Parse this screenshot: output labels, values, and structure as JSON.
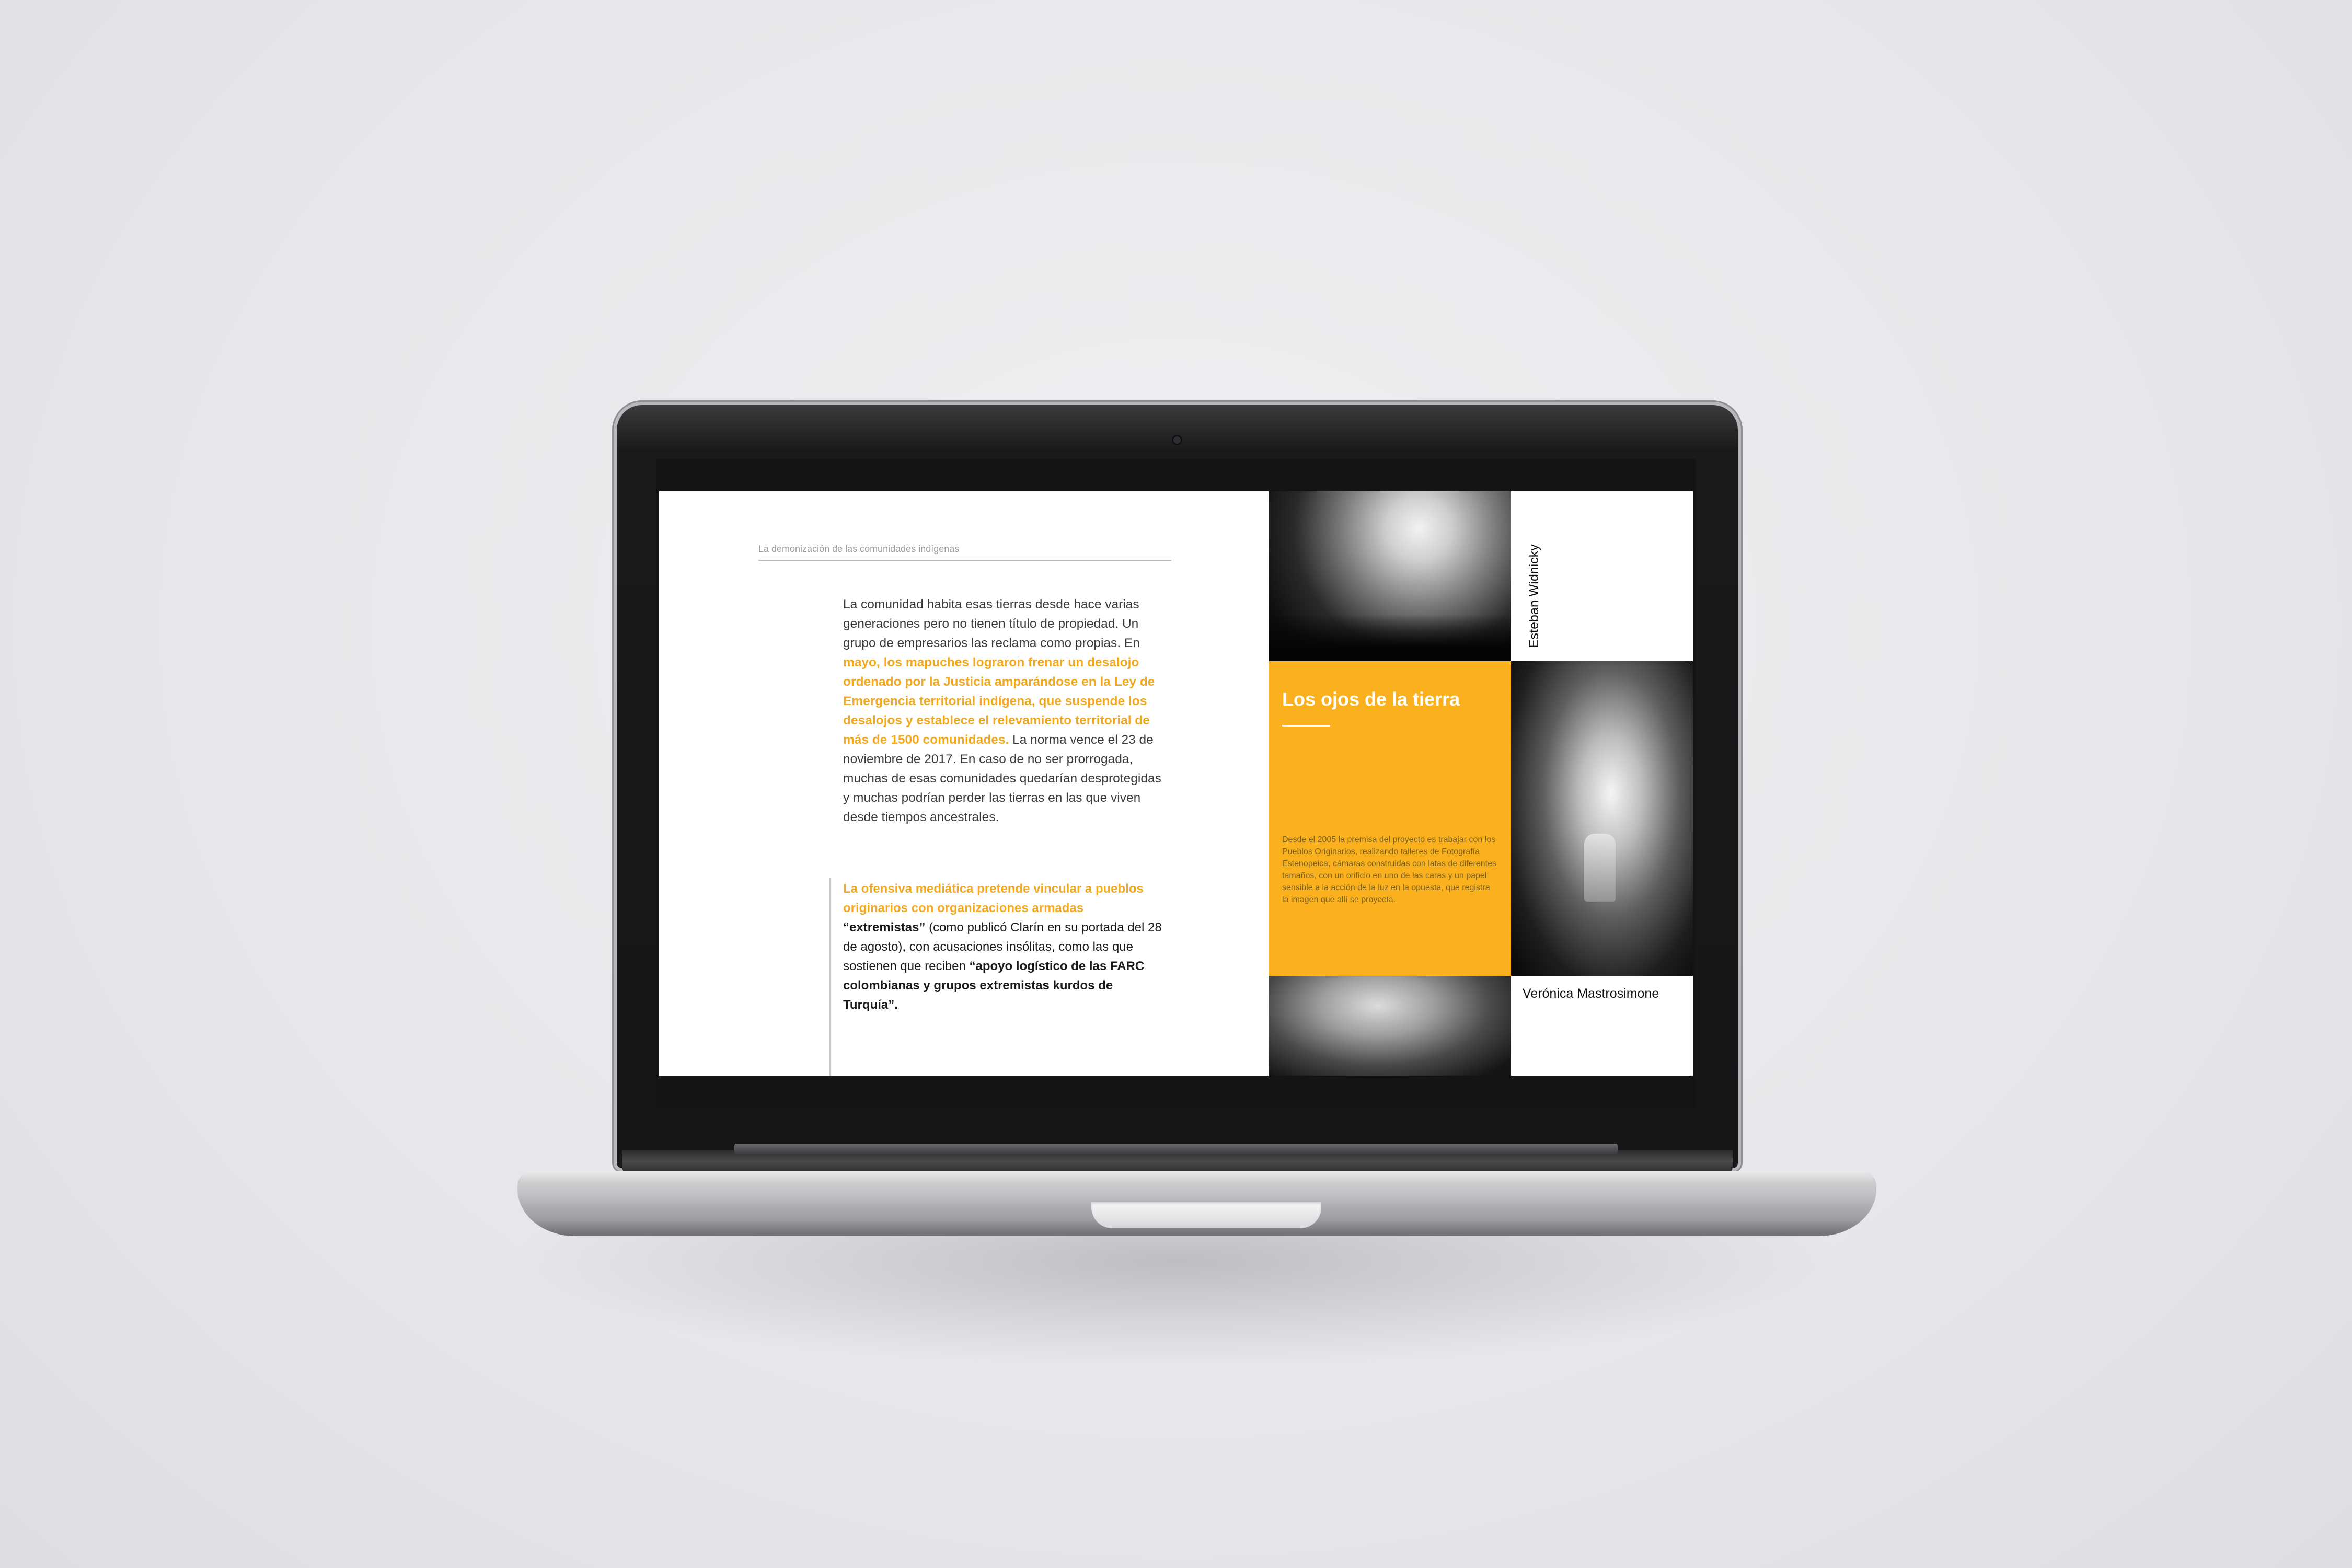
{
  "document": {
    "running_header": "La demonización de las comunidades indígenas",
    "body_paragraph": {
      "part1": "La comunidad habita esas tierras desde hace varias generaciones pero no tienen título de propiedad. Un grupo de empresarios las reclama como propias. En ",
      "highlight": "mayo, los mapuches lograron frenar un desalojo ordenado por la Justicia amparándose en la Ley de Emergencia territorial indígena, que suspende los desalojos y establece el relevamiento territorial de más de 1500 comunidades.",
      "part2": " La norma vence el 23 de noviembre de 2017. En caso de no ser prorrogada, muchas de esas comunidades quedarían desprotegidas y muchas podrían perder las tierras en las que viven desde tiempos ancestrales."
    },
    "pull_quote": {
      "highlight": "La ofensiva mediática pretende vincular a pueblos originarios con organizaciones armadas",
      "bold1": " “extremistas”",
      "text1": " (como publicó Clarín en su portada del 28 de agosto), con acusaciones insólitas, como las que sostienen que reciben ",
      "bold2": "“apoyo logístico de las FARC colombianas y grupos extremistas kurdos de Turquía”."
    }
  },
  "feature": {
    "title": "Los ojos de la tierra",
    "body": "Desde el 2005 la premisa del proyecto es trabajar con los Pueblos Originarios, realizando talleres de Fotografía Estenopeica, cámaras construidas con latas de diferentes tamaños, con un orificio en uno de las caras y un papel sensible a la acción de la luz en la opuesta, que registra la imagen que allí se proyecta.",
    "credit_top": "Esteban Widnicky",
    "credit_bottom": "Verónica Mastrosimone"
  },
  "colors": {
    "accent": "#fbb01d",
    "highlight_text": "#f2a81f",
    "screen_bezel": "#141414",
    "page": "#ffffff"
  }
}
